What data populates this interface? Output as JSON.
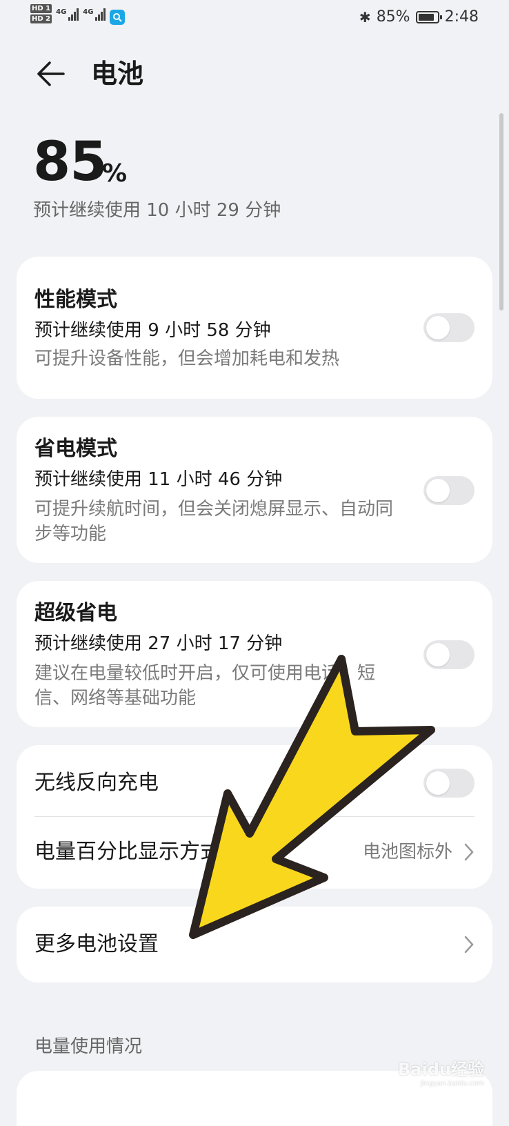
{
  "status_bar": {
    "hd1": "HD 1",
    "hd2": "HD 2",
    "net1": "4G",
    "net2": "4G",
    "battery_percent_text": "85%",
    "battery_level": 0.85,
    "time": "2:48"
  },
  "header": {
    "title": "电池"
  },
  "battery": {
    "percent": "85",
    "unit": "%",
    "estimate": "预计继续使用 10 小时 29 分钟"
  },
  "modes": [
    {
      "title": "性能模式",
      "estimate": "预计继续使用 9 小时 58 分钟",
      "desc": "可提升设备性能，但会增加耗电和发热",
      "enabled": false
    },
    {
      "title": "省电模式",
      "estimate": "预计继续使用 11 小时 46 分钟",
      "desc": "可提升续航时间，但会关闭熄屏显示、自动同步等功能",
      "enabled": false
    },
    {
      "title": "超级省电",
      "estimate": "预计继续使用 27 小时 17 分钟",
      "desc": "建议在电量较低时开启，仅可使用电话、短信、网络等基础功能",
      "enabled": false
    }
  ],
  "wireless_reverse": {
    "title": "无线反向充电",
    "enabled": false
  },
  "percent_display": {
    "title": "电量百分比显示方式",
    "value": "电池图标外"
  },
  "more_settings": {
    "title": "更多电池设置"
  },
  "usage_section": {
    "label": "电量使用情况"
  },
  "watermark": {
    "brand": "Baidu经验",
    "url": "jingyan.baidu.com"
  },
  "colors": {
    "accent_arrow": "#f9d71c",
    "background": "#f1f2f5",
    "card": "#ffffff"
  }
}
